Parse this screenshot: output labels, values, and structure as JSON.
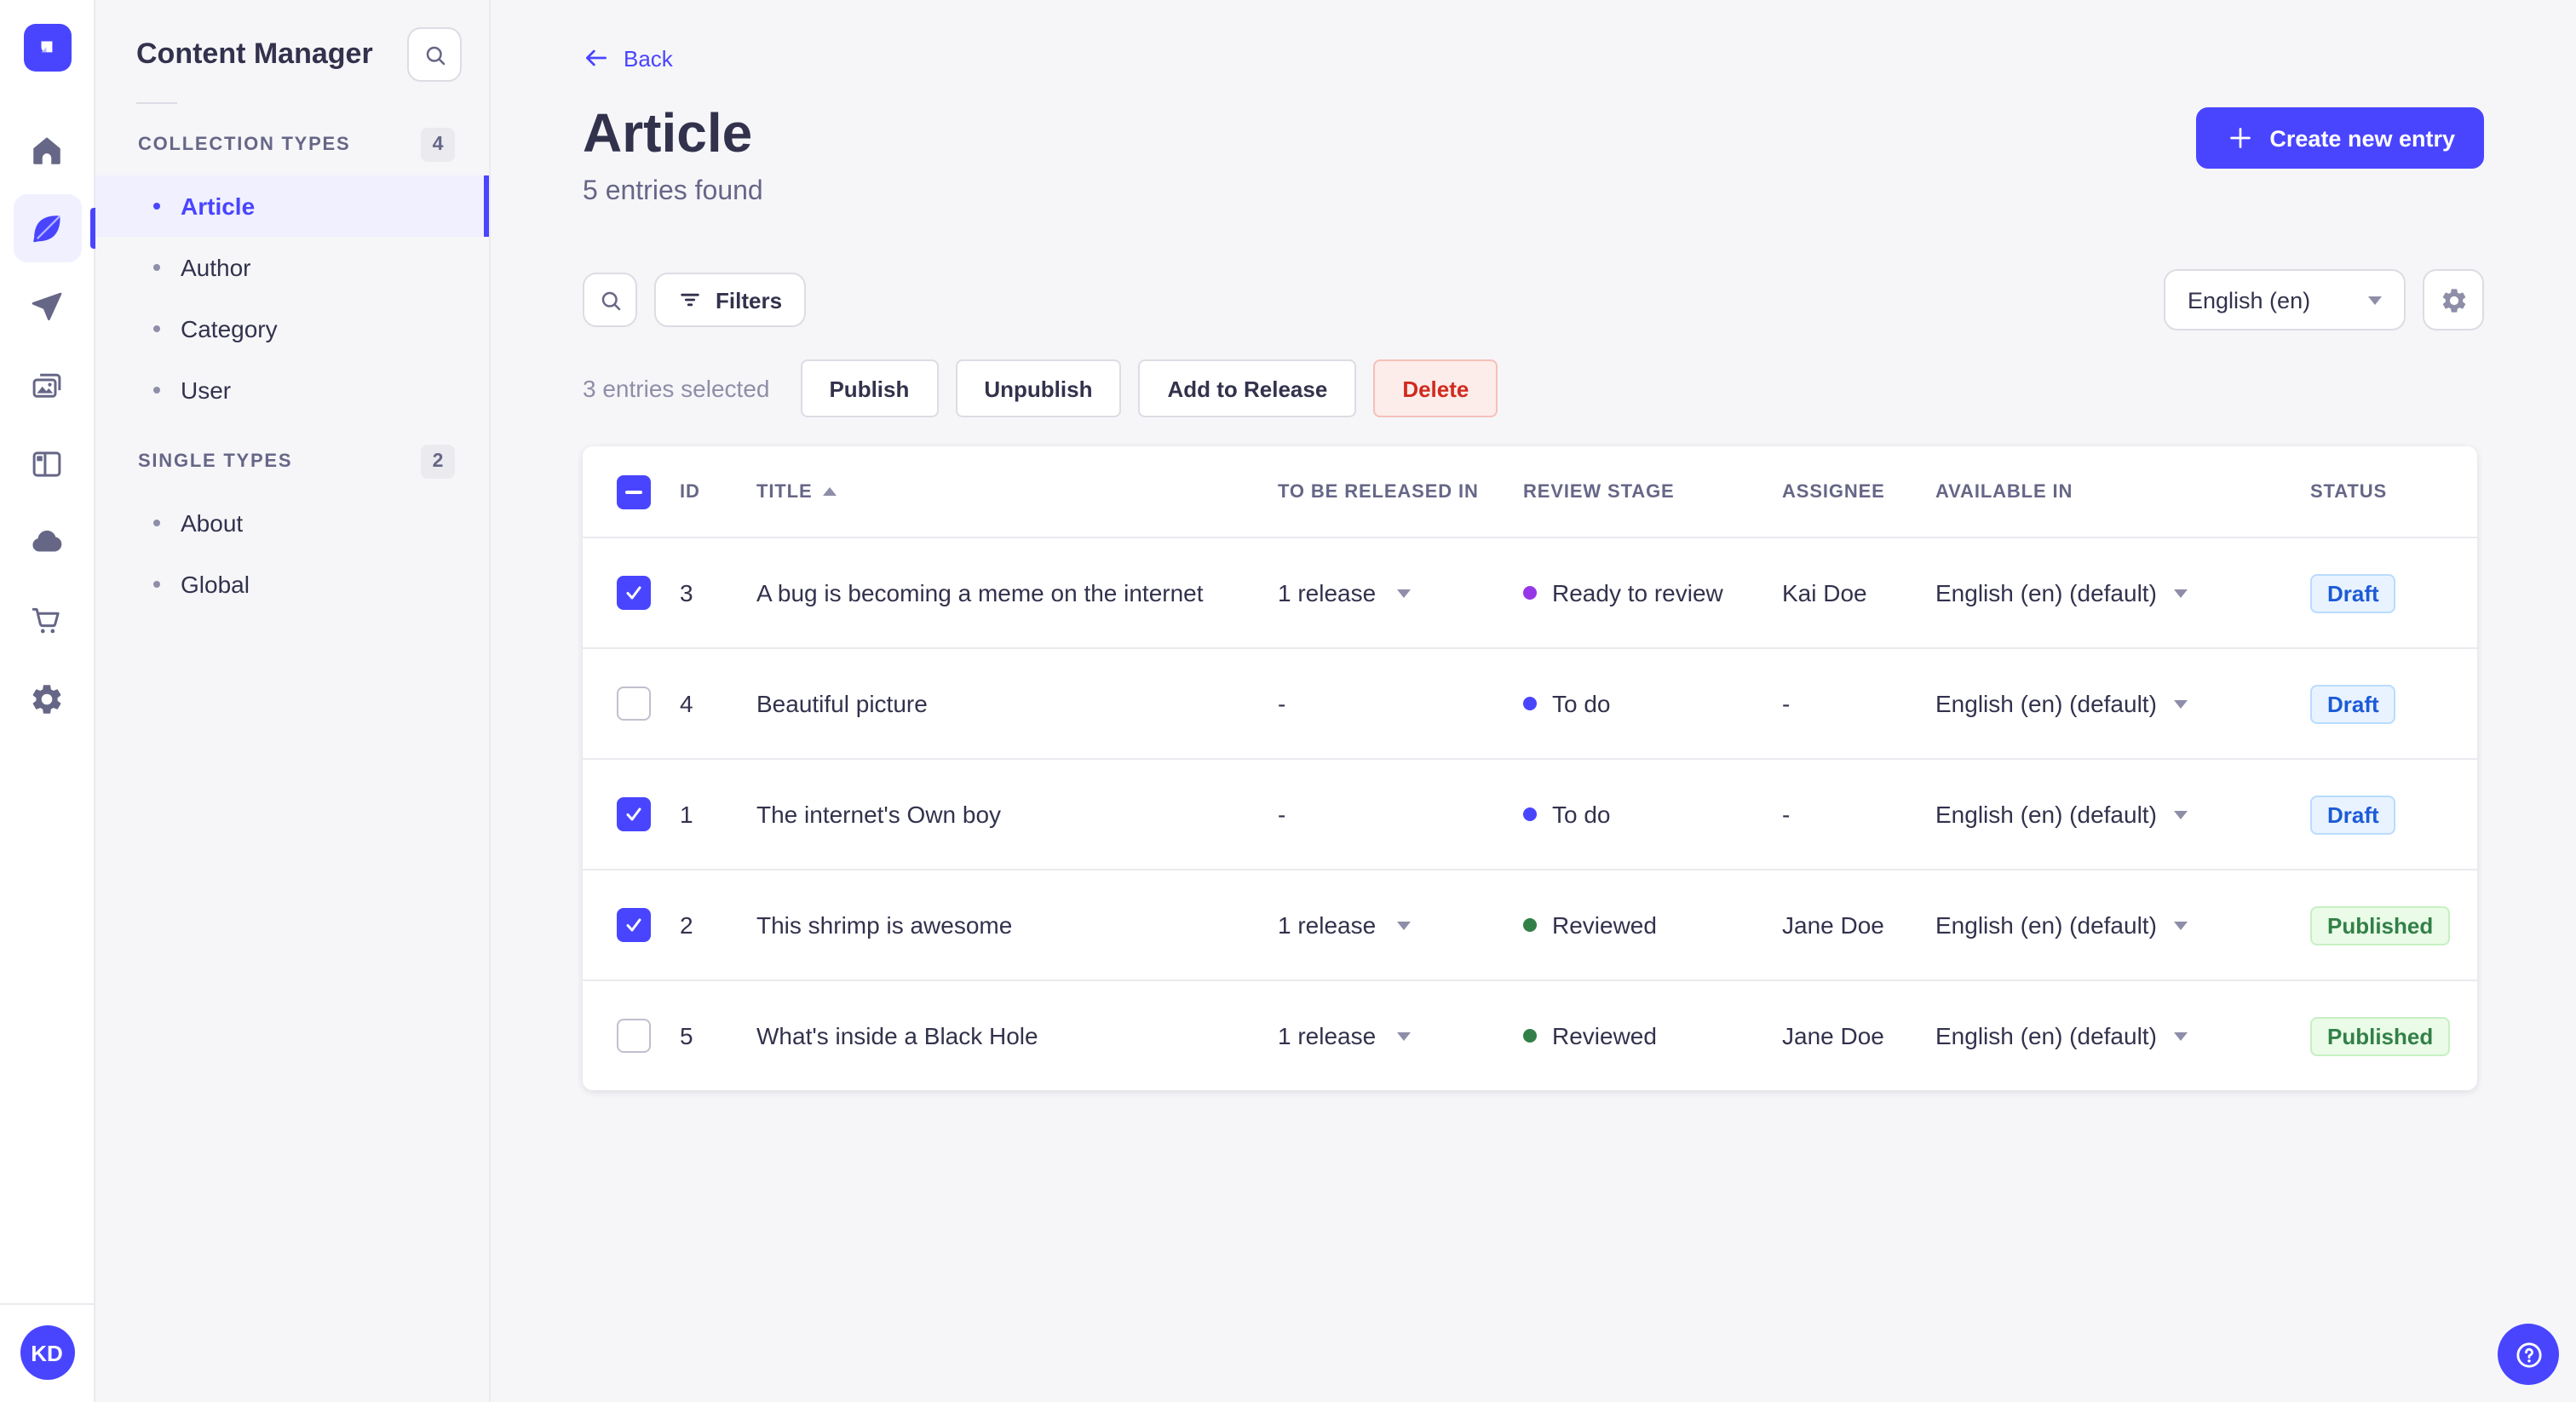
{
  "colors": {
    "primary": "#4945ff",
    "primary_light_bg": "#f0f0ff",
    "danger_text": "#d02b20",
    "danger_bg": "#fcecea",
    "danger_border": "#f5c0b8",
    "draft_text": "#1c5bd6",
    "draft_bg": "#e9f3ff",
    "draft_border": "#b8dcff",
    "published_text": "#328048",
    "published_bg": "#eafbe7",
    "published_border": "#c6f0c2",
    "stage_todo_dot": "#4945ff",
    "stage_ready_to_review_dot": "#9736e8",
    "stage_reviewed_dot": "#328048"
  },
  "rail": {
    "icons": [
      "home-icon",
      "feather-pen-icon",
      "paper-plane-icon",
      "media-library-icon",
      "layout-builder-icon",
      "cloud-icon",
      "shopping-cart-icon",
      "gear-icon"
    ],
    "active_icon": "feather-pen-icon",
    "avatar_initials": "KD"
  },
  "subnav": {
    "title": "Content Manager",
    "search_icon": "search-icon",
    "sections": [
      {
        "label": "COLLECTION TYPES",
        "count": "4",
        "items": [
          {
            "label": "Article",
            "active": true
          },
          {
            "label": "Author"
          },
          {
            "label": "Category"
          },
          {
            "label": "User"
          }
        ]
      },
      {
        "label": "SINGLE TYPES",
        "count": "2",
        "items": [
          {
            "label": "About"
          },
          {
            "label": "Global"
          }
        ]
      }
    ]
  },
  "page": {
    "back_label": "Back",
    "title": "Article",
    "subtitle": "5 entries found",
    "create_button_label": "Create new entry"
  },
  "toolbar": {
    "filters_label": "Filters",
    "locale_selected": "English (en)"
  },
  "selection": {
    "summary": "3 entries selected",
    "actions": [
      {
        "label": "Publish",
        "name": "publish-button"
      },
      {
        "label": "Unpublish",
        "name": "unpublish-button"
      },
      {
        "label": "Add to Release",
        "name": "add-to-release-button"
      },
      {
        "label": "Delete",
        "name": "delete-button",
        "danger": true
      }
    ]
  },
  "table": {
    "header_checkbox_state": "indeterminate",
    "columns": [
      {
        "label": "ID"
      },
      {
        "label": "TITLE",
        "sorted": "asc"
      },
      {
        "label": "TO BE RELEASED IN"
      },
      {
        "label": "REVIEW STAGE"
      },
      {
        "label": "ASSIGNEE"
      },
      {
        "label": "AVAILABLE IN"
      },
      {
        "label": "STATUS"
      }
    ],
    "rows": [
      {
        "selected": true,
        "id": "3",
        "title": "A bug is becoming a meme on the internet",
        "to_be_released_in": "1 release",
        "release_dropdown": true,
        "review_stage": "Ready to review",
        "stage_color": "#9736e8",
        "assignee": "Kai Doe",
        "available_in": "English (en) (default)",
        "status": "Draft"
      },
      {
        "selected": false,
        "id": "4",
        "title": "Beautiful picture",
        "to_be_released_in": "-",
        "release_dropdown": false,
        "review_stage": "To do",
        "stage_color": "#4945ff",
        "assignee": "-",
        "available_in": "English (en) (default)",
        "status": "Draft"
      },
      {
        "selected": true,
        "id": "1",
        "title": "The internet's Own boy",
        "to_be_released_in": "-",
        "release_dropdown": false,
        "review_stage": "To do",
        "stage_color": "#4945ff",
        "assignee": "-",
        "available_in": "English (en) (default)",
        "status": "Draft"
      },
      {
        "selected": true,
        "id": "2",
        "title": "This shrimp is awesome",
        "to_be_released_in": "1 release",
        "release_dropdown": true,
        "review_stage": "Reviewed",
        "stage_color": "#328048",
        "assignee": "Jane Doe",
        "available_in": "English (en) (default)",
        "status": "Published"
      },
      {
        "selected": false,
        "id": "5",
        "title": "What's inside a Black Hole",
        "to_be_released_in": "1 release",
        "release_dropdown": true,
        "review_stage": "Reviewed",
        "stage_color": "#328048",
        "assignee": "Jane Doe",
        "available_in": "English (en) (default)",
        "status": "Published"
      }
    ]
  },
  "help_fab_icon": "circle-question-icon"
}
